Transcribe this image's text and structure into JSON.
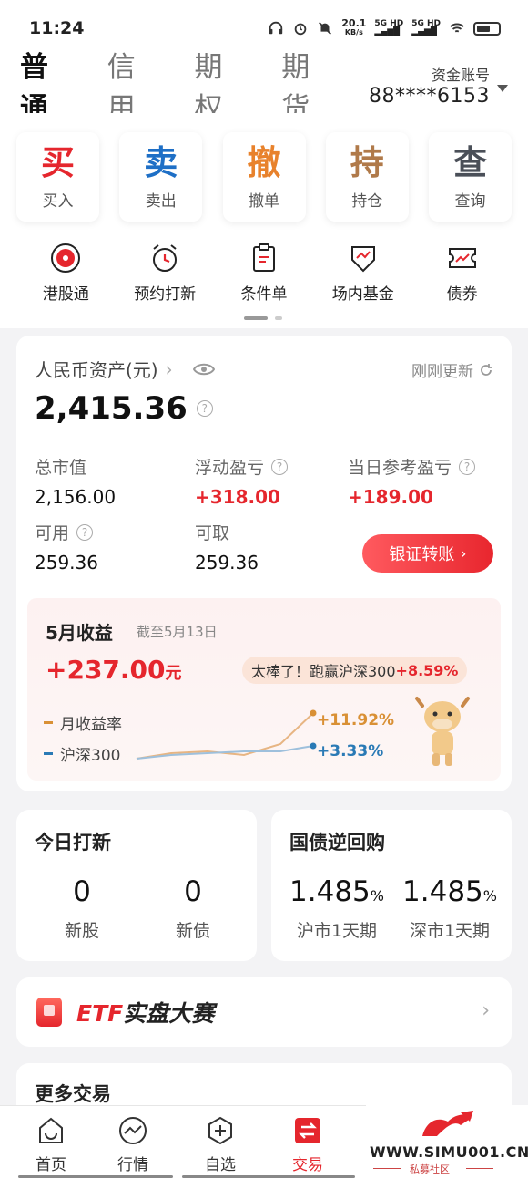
{
  "status": {
    "time": "11:24",
    "speed_top": "20.1",
    "speed_unit": "KB/s",
    "sig1": "5G HD",
    "sig2": "5G HD"
  },
  "tabs": [
    {
      "label": "普通"
    },
    {
      "label": "信用"
    },
    {
      "label": "期权"
    },
    {
      "label": "期货"
    }
  ],
  "account": {
    "label": "资金账号",
    "number": "88****6153"
  },
  "quick_actions": [
    {
      "big": "买",
      "small": "买入",
      "color": "#e5262d"
    },
    {
      "big": "卖",
      "small": "卖出",
      "color": "#1e6fc6"
    },
    {
      "big": "撤",
      "small": "撤单",
      "color": "#e8822c"
    },
    {
      "big": "持",
      "small": "持仓",
      "color": "#b07a4a"
    },
    {
      "big": "查",
      "small": "查询",
      "color": "#4a4f58"
    }
  ],
  "icon_row": [
    {
      "label": "港股通",
      "icon": "hk-flower-icon"
    },
    {
      "label": "预约打新",
      "icon": "alarm-clock-icon"
    },
    {
      "label": "条件单",
      "icon": "clipboard-icon"
    },
    {
      "label": "场内基金",
      "icon": "fund-shield-icon"
    },
    {
      "label": "债券",
      "icon": "bond-ticket-icon"
    }
  ],
  "asset": {
    "title": "人民币资产(元)",
    "refresh": "刚刚更新",
    "total": "2,415.36",
    "market_value_label": "总市值",
    "market_value": "2,156.00",
    "floating_pl_label": "浮动盈亏",
    "floating_pl": "+318.00",
    "daily_pl_label": "当日参考盈亏",
    "daily_pl": "+189.00",
    "available_label": "可用",
    "available": "259.36",
    "withdrawable_label": "可取",
    "withdrawable": "259.36",
    "transfer_btn": "银证转账"
  },
  "monthly": {
    "title": "5月收益",
    "date": "截至5月13日",
    "value": "+237.00",
    "unit": "元",
    "bubble_prefix": "太棒了！跑赢沪深300",
    "bubble_pct": "+8.59%",
    "legend_return": "月收益率",
    "legend_index": "沪深300",
    "pct_return": "+11.92%",
    "pct_index": "+3.33%",
    "return_color": "#d99035",
    "index_color": "#2a7ab5"
  },
  "ipo": {
    "title": "今日打新",
    "stock_count": "0",
    "stock_label": "新股",
    "bond_count": "0",
    "bond_label": "新债"
  },
  "repo": {
    "title": "国债逆回购",
    "sh_rate": "1.485",
    "sh_label": "沪市1天期",
    "sz_rate": "1.485",
    "sz_label": "深市1天期",
    "pct": "%"
  },
  "etf": {
    "prefix": "ETF",
    "suffix": "实盘大赛"
  },
  "more": {
    "title": "更多交易"
  },
  "nav": [
    {
      "label": "首页",
      "icon": "home-icon"
    },
    {
      "label": "行情",
      "icon": "market-icon"
    },
    {
      "label": "自选",
      "icon": "watchlist-icon"
    },
    {
      "label": "交易",
      "icon": "trade-icon"
    }
  ],
  "watermark": {
    "text": "WWW.SIMU001.CN",
    "sub": "私募社区"
  }
}
